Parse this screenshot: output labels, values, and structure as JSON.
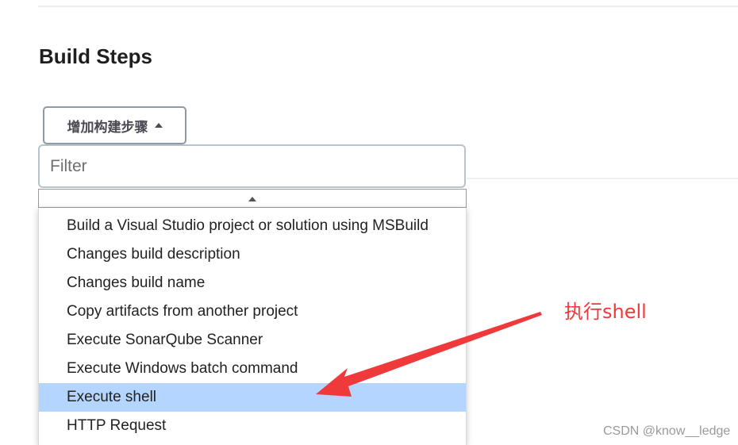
{
  "section": {
    "title": "Build Steps"
  },
  "add_step_button": {
    "label": "增加构建步骤"
  },
  "filter": {
    "placeholder": "Filter",
    "value": ""
  },
  "dropdown": {
    "items": [
      {
        "label": "Build a Visual Studio project or solution using MSBuild",
        "selected": false
      },
      {
        "label": "Changes build description",
        "selected": false
      },
      {
        "label": "Changes build name",
        "selected": false
      },
      {
        "label": "Copy artifacts from another project",
        "selected": false
      },
      {
        "label": "Execute SonarQube Scanner",
        "selected": false
      },
      {
        "label": "Execute Windows batch command",
        "selected": false
      },
      {
        "label": "Execute shell",
        "selected": true
      },
      {
        "label": "HTTP Request",
        "selected": false
      }
    ],
    "highlight_color": "#b3d5ff"
  },
  "annotation": {
    "text": "执行shell",
    "color": "#f0393b"
  },
  "watermark": {
    "text": "CSDN @know__ledge"
  },
  "icons": {
    "button_caret": "caret-up-icon",
    "scroll_arrow": "scroll-up-arrow-icon"
  }
}
